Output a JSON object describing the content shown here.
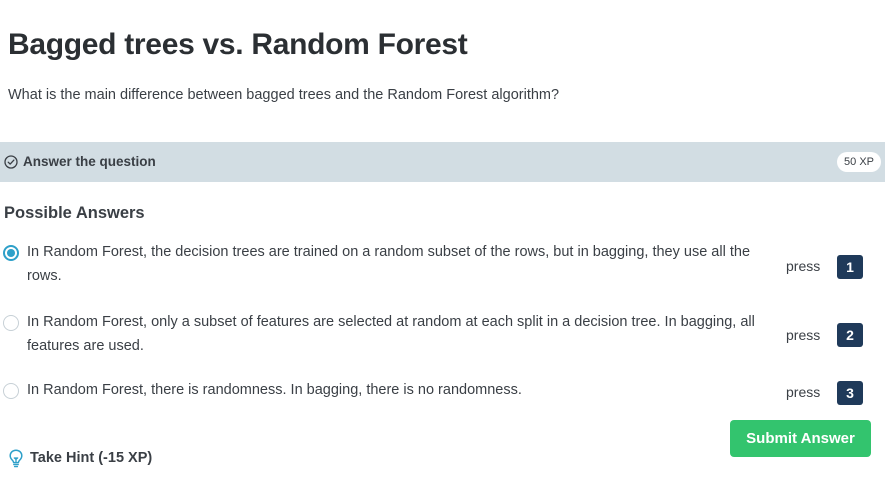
{
  "page": {
    "title": "Bagged trees vs. Random Forest",
    "question": "What is the main difference between bagged trees and the Random Forest algorithm?"
  },
  "answer_bar": {
    "icon": "check-circle-icon",
    "label": "Answer the question",
    "xp": "50 XP"
  },
  "answers": {
    "heading": "Possible Answers",
    "selected_index": 0,
    "press_label": "press",
    "options": [
      {
        "text": "In Random Forest, the decision trees are trained on a random subset of the rows, but in bagging, they use all the rows.",
        "key": "1"
      },
      {
        "text": "In Random Forest, only a subset of features are selected at random at each split in a decision tree. In bagging, all features are used.",
        "key": "2"
      },
      {
        "text": "In Random Forest, there is randomness. In bagging, there is no randomness.",
        "key": "3"
      }
    ]
  },
  "actions": {
    "submit_label": "Submit Answer",
    "hint_label": "Take Hint (-15 XP)",
    "hint_icon": "lightbulb-icon"
  },
  "colors": {
    "accent_green": "#33c46e",
    "radio_selected": "#2ea0c9",
    "key_badge": "#1f3a5a",
    "answer_bar_bg": "#d2dde3"
  }
}
